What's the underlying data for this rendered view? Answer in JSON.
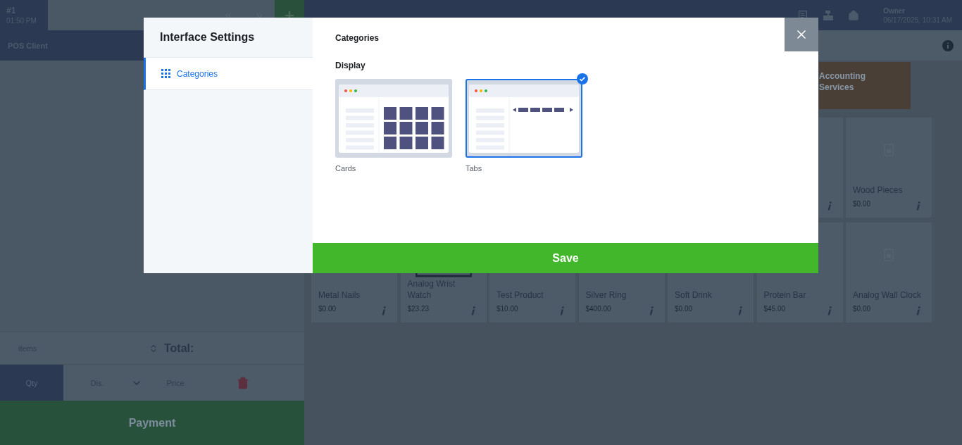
{
  "ticket": {
    "number": "#1",
    "time": "01:50 PM"
  },
  "client": "POS Client",
  "header": {
    "user": "Owner",
    "datetime": "06/17/2025, 10:31 AM"
  },
  "categories": [
    {
      "name": "Accounting Services"
    }
  ],
  "product_rows": [
    {
      "cards": [
        {
          "kind": "covered"
        },
        {
          "kind": "placeholder_product",
          "name": "Wood Pieces",
          "price": "$0.00"
        }
      ]
    },
    {
      "cards": [
        {
          "kind": "product",
          "name": "Metal Nails",
          "price": "$0.00"
        },
        {
          "kind": "photo_product",
          "name": "Analog Wrist Watch",
          "price": "$23.23"
        },
        {
          "kind": "product",
          "name": "Test Product",
          "price": "$10.00"
        },
        {
          "kind": "product",
          "name": "Silver Ring",
          "price": "$400.00"
        },
        {
          "kind": "product",
          "name": "Soft Drink",
          "price": "$0.00"
        },
        {
          "kind": "product",
          "name": "Protein Bar",
          "price": "$45.00"
        },
        {
          "kind": "placeholder_product",
          "name": "Analog Wall Clock",
          "price": "$0.00"
        }
      ]
    }
  ],
  "cart": {
    "items_label": "items",
    "total_label": "Total:",
    "modes": [
      {
        "label": "Qty",
        "selected": true
      },
      {
        "label": "Dis.",
        "selected": false
      },
      {
        "label": "Price",
        "selected": false
      }
    ],
    "payment": "Payment"
  },
  "modal": {
    "title": "Interface Settings",
    "menu": [
      {
        "label": "Categories",
        "selected": true
      }
    ],
    "section_title": "Categories",
    "display_label": "Display",
    "options": [
      {
        "label": "Cards",
        "kind": "cards",
        "selected": false
      },
      {
        "label": "Tabs",
        "kind": "tabs",
        "selected": true
      }
    ],
    "save": "Save"
  }
}
